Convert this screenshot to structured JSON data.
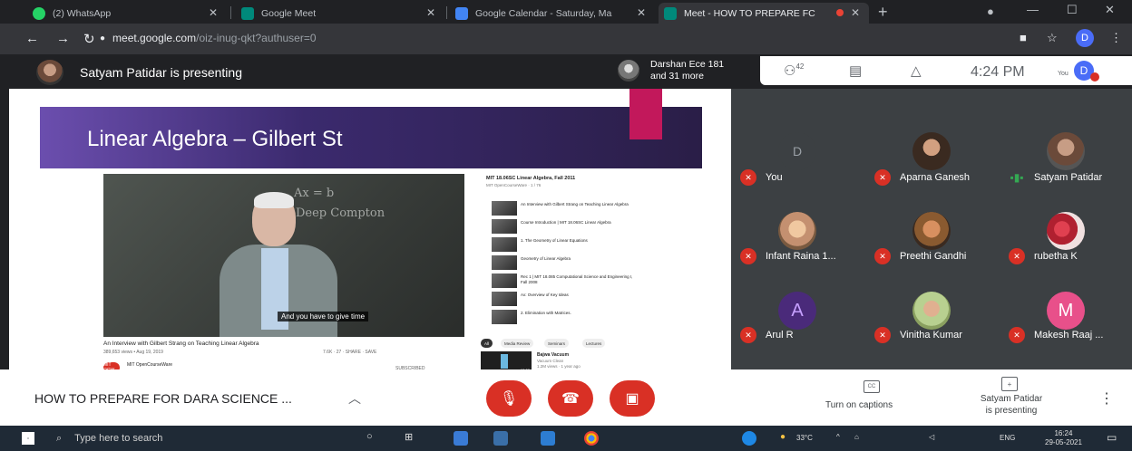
{
  "browser": {
    "tabs": [
      {
        "title": "(2) WhatsApp",
        "color": "#25D366"
      },
      {
        "title": "Google Meet",
        "color": "#00897B"
      },
      {
        "title": "Google Calendar - Saturday, Ma",
        "color": "#4285F4"
      },
      {
        "title": "Meet - HOW TO PREPARE FC",
        "color": "#00897B"
      }
    ],
    "url_host": "meet.google.com",
    "url_path": "/oiz-inug-qkt?authuser=0",
    "profile_initial": "D"
  },
  "meet": {
    "presenting_banner": "Satyam Patidar is presenting",
    "participants_line1": "Darshan Ece 181",
    "participants_line2": "and 31 more",
    "people_count": "42",
    "time": "4:24 PM",
    "you_label": "You",
    "self_initial": "D"
  },
  "slide": {
    "title": "Linear Algebra – Gilbert St",
    "video_caption": "And you have to give time",
    "video_title": "An Interview with Gilbert Strang on Teaching Linear Algebra",
    "video_meta": "389,653 views • Aug 19, 2019",
    "video_actions": "7.6K  ·  27  ·  SHARE  ·  SAVE",
    "channel_logo": "MIT OCW",
    "channel_name": "MIT OpenCourseWare",
    "subscribe_label": "SUBSCRIBED",
    "board_text_1": "Ax = b",
    "board_text_2": "Deep Compton",
    "playlist_title": "MIT 18.06SC Linear Algebra, Fall 2011",
    "playlist_sub": "MIT OpenCourseWare · 1 / 76",
    "playlist_items": [
      "An Interview with Gilbert Strang on Teaching Linear Algebra",
      "Course Introduction | MIT 18.06SC Linear Algebra",
      "1. The Geometry of Linear Equations",
      "Geometry of Linear Algebra",
      "Rec 1 | MIT 18.085 Computational Science and Engineering I, Fall 2008",
      "Ax: Overview of Key Ideas",
      "2. Elimination with Matrices."
    ],
    "chips": [
      "All",
      "Media Review",
      "Seminars",
      "Lectures"
    ],
    "rec_title": "Bajwa Vacuum",
    "rec_sub1": "Vacuum Clean",
    "rec_sub2": "1.2M views · 1 year ago",
    "rec_duration": "10:00"
  },
  "participants": [
    {
      "name": "You",
      "avatar": "D",
      "muted": true,
      "color": "#5f6368"
    },
    {
      "name": "Aparna Ganesh",
      "avatar": "",
      "muted": true,
      "color": "#7a5a4a"
    },
    {
      "name": "Satyam Patidar",
      "avatar": "",
      "muted": false,
      "color": "#8a6a5a"
    },
    {
      "name": "Infant Raina 1...",
      "avatar": "",
      "muted": true,
      "color": "#c4a07c"
    },
    {
      "name": "Preethi Gandhi",
      "avatar": "",
      "muted": true,
      "color": "#b07848"
    },
    {
      "name": "rubetha K",
      "avatar": "",
      "muted": true,
      "color": "#c03040"
    },
    {
      "name": "Arul R",
      "avatar": "A",
      "muted": true,
      "color": "#4a2a7a"
    },
    {
      "name": "Vinitha Kumar",
      "avatar": "",
      "muted": true,
      "color": "#a8c070"
    },
    {
      "name": "Makesh Raaj ...",
      "avatar": "M",
      "muted": true,
      "color": "#e8508a"
    }
  ],
  "bottom": {
    "meeting_title": "HOW TO PREPARE FOR DARA SCIENCE ...",
    "cc_label": "Turn on captions",
    "cc_icon": "CC",
    "presenting_line1": "Satyam Patidar",
    "presenting_line2": "is presenting"
  },
  "taskbar": {
    "search_placeholder": "Type here to search",
    "temp": "33°C",
    "lang": "ENG",
    "clock_time": "16:24",
    "clock_date": "29-05-2021"
  }
}
